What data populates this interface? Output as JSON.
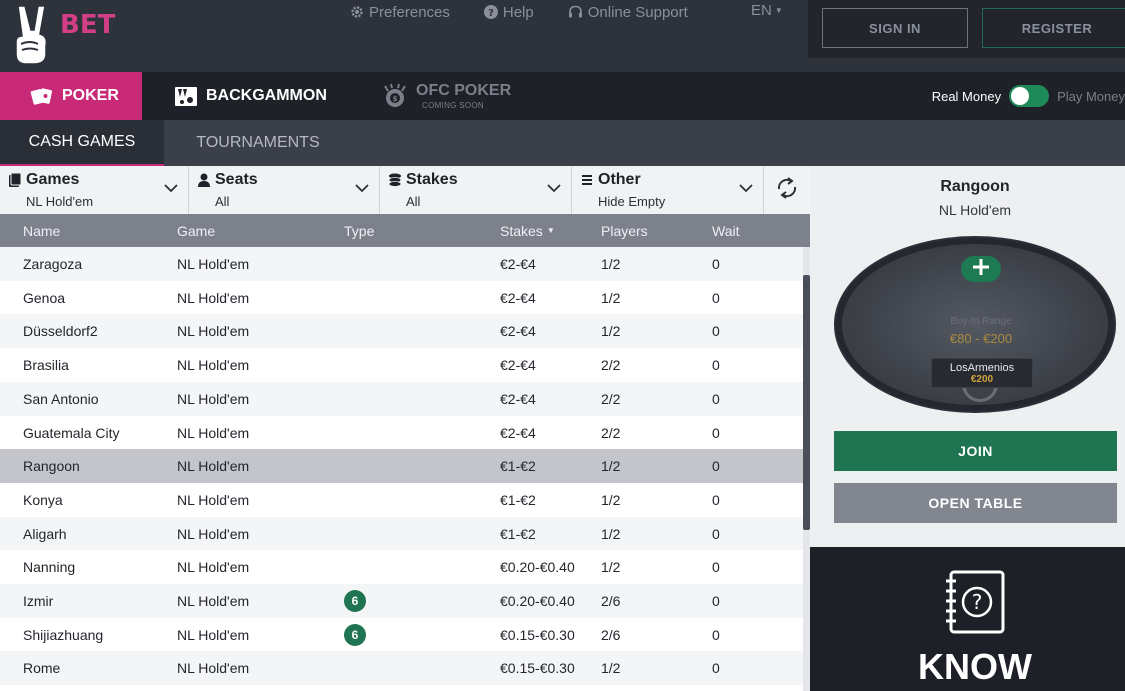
{
  "brand": {
    "name": "BET"
  },
  "topbar": {
    "links": [
      {
        "label": "Preferences",
        "icon": "gear-icon"
      },
      {
        "label": "Help",
        "icon": "help-circle-icon"
      },
      {
        "label": "Online Support",
        "icon": "headset-icon"
      }
    ],
    "language": "EN",
    "sign_in": "SIGN IN",
    "register": "REGISTER"
  },
  "product_nav": {
    "tabs": [
      {
        "label": "POKER",
        "icon": "cards-icon",
        "active": true
      },
      {
        "label": "BACKGAMMON",
        "icon": "backgammon-board-icon",
        "active": false
      },
      {
        "label": "OFC POKER",
        "sub": "COMING SOON",
        "icon": "ofc-chip-icon",
        "active": false
      }
    ],
    "real_money": "Real Money",
    "play_money": "Play Money"
  },
  "sub_nav": {
    "tabs": [
      {
        "label": "CASH GAMES",
        "active": true
      },
      {
        "label": "TOURNAMENTS",
        "active": false
      }
    ]
  },
  "filters": [
    {
      "title": "Games",
      "value": "NL Hold'em",
      "icon": "deck-icon"
    },
    {
      "title": "Seats",
      "value": "All",
      "icon": "person-icon"
    },
    {
      "title": "Stakes",
      "value": "All",
      "icon": "chip-stack-icon"
    },
    {
      "title": "Other",
      "value": "Hide Empty",
      "icon": "list-icon"
    }
  ],
  "table": {
    "columns": [
      "Name",
      "Game",
      "Type",
      "Stakes",
      "Players",
      "Wait"
    ],
    "sorted_column": "Stakes",
    "rows": [
      {
        "name": "Zaragoza",
        "game": "NL Hold'em",
        "type": "",
        "stakes": "€2-€4",
        "players": "1/2",
        "wait": "0"
      },
      {
        "name": "Genoa",
        "game": "NL Hold'em",
        "type": "",
        "stakes": "€2-€4",
        "players": "1/2",
        "wait": "0"
      },
      {
        "name": "Düsseldorf2",
        "game": "NL Hold'em",
        "type": "",
        "stakes": "€2-€4",
        "players": "1/2",
        "wait": "0"
      },
      {
        "name": "Brasilia",
        "game": "NL Hold'em",
        "type": "",
        "stakes": "€2-€4",
        "players": "2/2",
        "wait": "0"
      },
      {
        "name": "San Antonio",
        "game": "NL Hold'em",
        "type": "",
        "stakes": "€2-€4",
        "players": "2/2",
        "wait": "0"
      },
      {
        "name": "Guatemala City",
        "game": "NL Hold'em",
        "type": "",
        "stakes": "€2-€4",
        "players": "2/2",
        "wait": "0"
      },
      {
        "name": "Rangoon",
        "game": "NL Hold'em",
        "type": "",
        "stakes": "€1-€2",
        "players": "1/2",
        "wait": "0",
        "selected": true
      },
      {
        "name": "Konya",
        "game": "NL Hold'em",
        "type": "",
        "stakes": "€1-€2",
        "players": "1/2",
        "wait": "0"
      },
      {
        "name": "Aligarh",
        "game": "NL Hold'em",
        "type": "",
        "stakes": "€1-€2",
        "players": "1/2",
        "wait": "0"
      },
      {
        "name": "Nanning",
        "game": "NL Hold'em",
        "type": "",
        "stakes": "€0.20-€0.40",
        "players": "1/2",
        "wait": "0"
      },
      {
        "name": "Izmir",
        "game": "NL Hold'em",
        "type": "6",
        "stakes": "€0.20-€0.40",
        "players": "2/6",
        "wait": "0"
      },
      {
        "name": "Shijiazhuang",
        "game": "NL Hold'em",
        "type": "6",
        "stakes": "€0.15-€0.30",
        "players": "2/6",
        "wait": "0"
      },
      {
        "name": "Rome",
        "game": "NL Hold'em",
        "type": "",
        "stakes": "€0.15-€0.30",
        "players": "1/2",
        "wait": "0"
      }
    ]
  },
  "detail": {
    "table_name": "Rangoon",
    "game": "NL Hold'em",
    "buyin_label": "Buy-In Range",
    "buyin_range": "€80 - €200",
    "player_name": "LosArmenios",
    "player_stack": "€200",
    "join": "JOIN",
    "open_table": "OPEN TABLE"
  },
  "promo": {
    "text": "KNOW"
  },
  "colors": {
    "accent": "#c92a78",
    "green": "#1f7451"
  }
}
